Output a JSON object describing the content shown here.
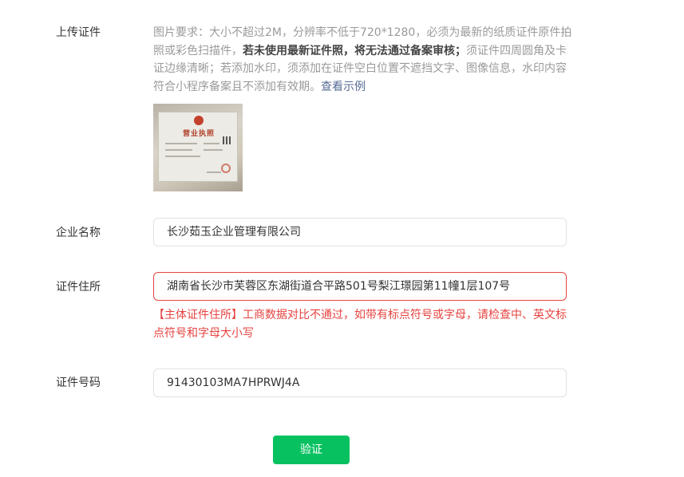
{
  "upload": {
    "label": "上传证件",
    "hint_part1": "图片要求：大小不超过2M，分辨率不低于720*1280，必须为最新的纸质证件原件拍照或彩色扫描件，",
    "hint_strong": "若未使用最新证件照，将无法通过备案审核；",
    "hint_part2": "须证件四周圆角及卡证边缘清晰；若添加水印，须添加在证件空白位置不遮挡文字、图像信息，水印内容符合小程序备案且不添加有效期。",
    "hint_link": "查看示例",
    "thumbnail_title": "营业执照"
  },
  "company_name": {
    "label": "企业名称",
    "value": "长沙茹玉企业管理有限公司"
  },
  "address": {
    "label": "证件住所",
    "value": "湖南省长沙市芙蓉区东湖街道合平路501号梨江璟园第11幢1层107号",
    "error": "【主体证件住所】工商数据对比不通过，如带有标点符号或字母，请检查中、英文标点符号和字母大小写"
  },
  "license_number": {
    "label": "证件号码",
    "value": "91430103MA7HPRWJ4A"
  },
  "verify_button": {
    "label": "验证"
  },
  "colors": {
    "primary": "#07c160",
    "error": "#e64340",
    "link": "#576b95"
  }
}
